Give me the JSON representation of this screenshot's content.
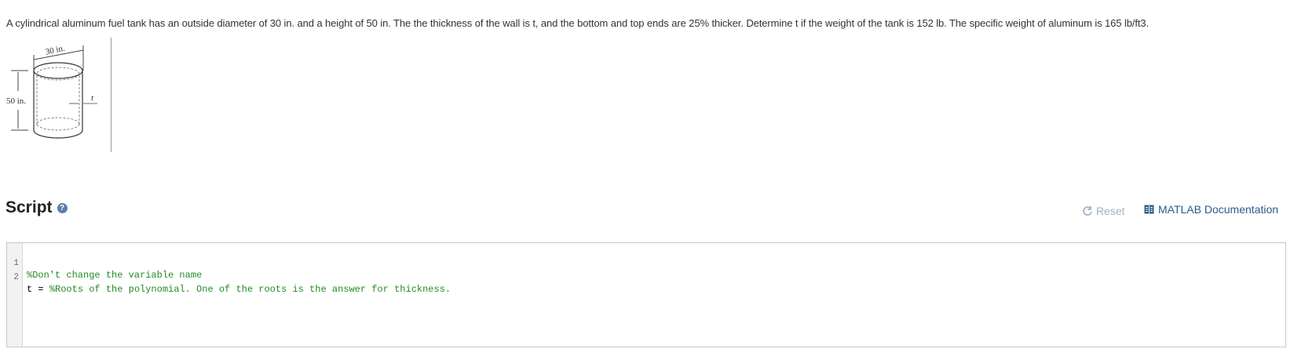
{
  "problem": {
    "text": "A cylindrical aluminum fuel tank has an outside diameter of 30 in. and a height of 50 in. The the thickness of the wall is t, and the bottom and top ends are 25% thicker. Determine t if the weight of the tank is 152 lb. The specific weight of aluminum is 165 lb/ft3."
  },
  "figure": {
    "diameter_label": "30 in.",
    "height_label": "50 in.",
    "thickness_label": "t"
  },
  "script": {
    "title": "Script",
    "help_icon": "?",
    "reset_label": "Reset",
    "doc_label": "MATLAB Documentation"
  },
  "editor": {
    "lines": [
      {
        "number": "1",
        "prefix": "",
        "comment": "%Don't change the variable name"
      },
      {
        "number": "2",
        "prefix": "t = ",
        "comment": "%Roots of the polynomial. One of the roots is the answer for thickness."
      }
    ]
  }
}
